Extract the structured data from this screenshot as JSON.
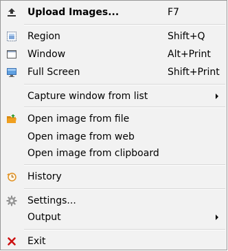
{
  "menu": {
    "upload": {
      "label": "Upload Images...",
      "shortcut": "F7",
      "icon": "upload-icon"
    },
    "region": {
      "label": "Region",
      "shortcut": "Shift+Q",
      "icon": "region-icon"
    },
    "window": {
      "label": "Window",
      "shortcut": "Alt+Print",
      "icon": "window-icon"
    },
    "fullscreen": {
      "label": "Full Screen",
      "shortcut": "Shift+Print",
      "icon": "monitor-icon"
    },
    "capture_window_list": {
      "label": "Capture window from list",
      "has_submenu": true
    },
    "open_file": {
      "label": "Open image from file",
      "icon": "folder-icon"
    },
    "open_web": {
      "label": "Open image from web"
    },
    "open_clipboard": {
      "label": "Open image from clipboard"
    },
    "history": {
      "label": "History",
      "icon": "history-icon"
    },
    "settings": {
      "label": "Settings...",
      "icon": "gear-icon"
    },
    "output": {
      "label": "Output",
      "has_submenu": true
    },
    "exit": {
      "label": "Exit",
      "icon": "close-icon"
    }
  },
  "colors": {
    "menu_background": "#f2f2f2",
    "menu_border": "#979797",
    "separator": "#d7d7d7",
    "exit_icon": "#cc1010",
    "folder_icon": "#f0a020"
  }
}
